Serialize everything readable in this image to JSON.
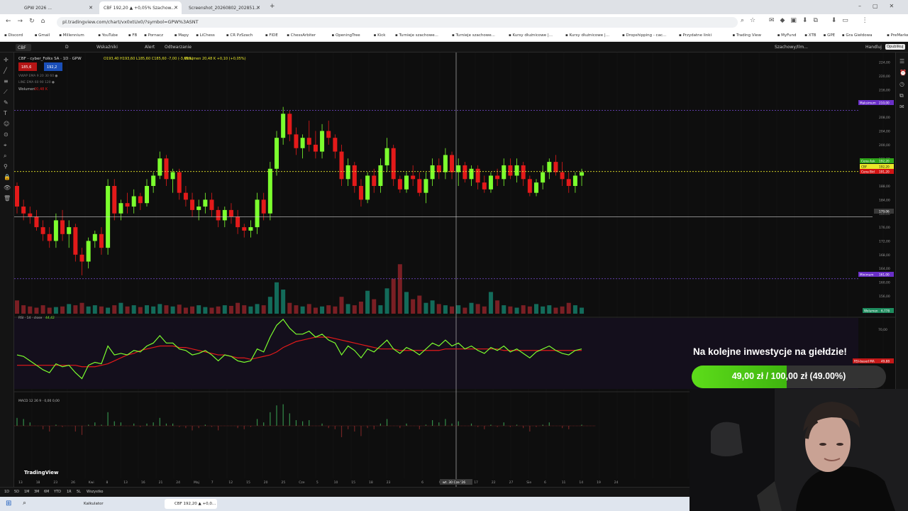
{
  "browser": {
    "tabs": [
      {
        "label": "GPW 2026 ..."
      },
      {
        "label": "CBF 192,20 ▲ +0,05% Szachow..."
      },
      {
        "label": "Screenshot_20260802_202851..."
      }
    ],
    "url": "pl.tradingview.com/chart/vx0xtUx0/?symbol=GPW%3ASNT",
    "bookmarks": [
      "Discord",
      "Gmail",
      "Millennium",
      "YouTube",
      "FB",
      "Pornacz",
      "Mapy",
      "LiChess",
      "CR PzSzach",
      "FIDE",
      "ChessArbiter",
      "OpeningTree",
      "Kick",
      "Turnieje szachowe...",
      "Turnieje szachowe...",
      "Kursy dłużnicowe |...",
      "Kursy dłużnicowe |...",
      "Dropshipping - cac...",
      "Przydatne linki",
      "Trading View",
      "MyFund",
      "XTB",
      "GPE",
      "Gra Giełdowa",
      "PreMarket (MU)"
    ]
  },
  "toolbar": {
    "symbol": "CBF",
    "interval": "D",
    "items": [
      "Wskaźniki",
      "Alert",
      "Odtwarzanie"
    ],
    "right_items": [
      "Szachowy/Ilm...",
      "Handluj",
      "Opublikuj"
    ]
  },
  "legend": {
    "title": "CBF - cyber_Folks SA · 1D · GPW",
    "ohlc": "O193,40 H193,60 L185,60 C185,60 -7,00 (-3,65%)",
    "volume_inline": "Wolumen 20,48 K  +0,10 (+0,05%)",
    "sell": "185,6",
    "buy": "192,2",
    "ind1": "VWAP EMA 9 20 30 60 ●",
    "ind2": "LINE EMA 60 90 120 ●",
    "vol_label": "Wolumen",
    "vol_value": "20,48 K",
    "rsi_label": "RSI · 14 · close",
    "rsi_value": "44,42",
    "macd_label": "MACD 12 26 9 · 0,00 0,00"
  },
  "price_axis": {
    "ticks": [
      "224,00",
      "220,00",
      "216,00",
      "212,00",
      "208,00",
      "204,00",
      "200,00",
      "196,00",
      "192,00",
      "188,00",
      "184,00",
      "180,00",
      "176,00",
      "172,00",
      "168,00",
      "164,00",
      "160,00",
      "156,00",
      "152,00"
    ],
    "max_label": "Maksimum",
    "max_value": "210,00",
    "min_label": "Minimum",
    "min_value": "161,00",
    "ask_label": "Cena Ask",
    "ask_value": "192,20",
    "cbf_label": "CBF",
    "cbf_value": "192,20",
    "bid_label": "Cena Bid",
    "bid_value": "191,20",
    "cursor_value": "179,06",
    "vol_axis_label": "Wolumen",
    "vol_axis_value": "6,778",
    "rsi_ticks": [
      "70,00",
      "60,00",
      "50,00"
    ],
    "rsi_badge": "RSI-based MA",
    "rsi_badge_value": "49,88"
  },
  "time_axis": {
    "labels": [
      "13",
      "18",
      "23",
      "26",
      "Kwi",
      "8",
      "13",
      "16",
      "21",
      "24",
      "Maj",
      "7",
      "12",
      "15",
      "20",
      "25",
      "Cze",
      "5",
      "10",
      "15",
      "18",
      "23",
      "30 Cze '26",
      "6",
      "9",
      "14",
      "17",
      "22",
      "27",
      "Sie",
      "6",
      "11",
      "14",
      "19",
      "24"
    ],
    "cursor_label": "wt. 30 Cze '26"
  },
  "bottom": {
    "ranges": [
      "1D",
      "5D",
      "1M",
      "3M",
      "6M",
      "YTD",
      "1R",
      "5L",
      "Wszystko"
    ],
    "brand": "TradingView"
  },
  "taskbar": {
    "apps": [
      "Kalkulator",
      "CBF 192,20 ▲ +0,0..."
    ]
  },
  "overlay": {
    "title": "Na kolejne inwestycje na giełdzie!",
    "progress_text": "49,00 zł / 100,00 zł (49.00%)",
    "progress": 0.49
  },
  "colors": {
    "up": "#7cff2e",
    "down": "#e31a1a",
    "volume_up": "#136b5a",
    "volume_down": "#7a1f24",
    "rsi": "#7cff2e",
    "rsi_ma": "#e31a1a",
    "accent_green": "#4cd30e",
    "max_badge": "#6a2fc7"
  },
  "chart_data": {
    "type": "candlestick",
    "ohlc": [
      [
        188,
        189,
        180,
        182
      ],
      [
        182,
        184,
        178,
        180
      ],
      [
        180,
        182,
        177,
        179
      ],
      [
        179,
        181,
        175,
        176
      ],
      [
        176,
        178,
        172,
        174
      ],
      [
        174,
        176,
        170,
        172
      ],
      [
        172,
        180,
        170,
        178
      ],
      [
        178,
        181,
        172,
        174
      ],
      [
        174,
        178,
        170,
        176
      ],
      [
        176,
        177,
        166,
        168
      ],
      [
        168,
        170,
        162,
        166
      ],
      [
        166,
        173,
        164,
        172
      ],
      [
        172,
        175,
        170,
        174
      ],
      [
        174,
        176,
        168,
        170
      ],
      [
        170,
        190,
        168,
        188
      ],
      [
        188,
        190,
        178,
        180
      ],
      [
        180,
        184,
        178,
        183
      ],
      [
        183,
        186,
        180,
        182
      ],
      [
        182,
        187,
        180,
        185
      ],
      [
        185,
        186,
        181,
        183
      ],
      [
        183,
        190,
        182,
        188
      ],
      [
        188,
        192,
        186,
        191
      ],
      [
        191,
        198,
        190,
        196
      ],
      [
        196,
        197,
        188,
        190
      ],
      [
        190,
        193,
        186,
        192
      ],
      [
        192,
        193,
        184,
        186
      ],
      [
        186,
        188,
        182,
        184
      ],
      [
        184,
        186,
        179,
        181
      ],
      [
        181,
        184,
        178,
        182
      ],
      [
        182,
        186,
        180,
        184
      ],
      [
        184,
        186,
        179,
        181
      ],
      [
        181,
        182,
        176,
        178
      ],
      [
        178,
        182,
        176,
        181
      ],
      [
        181,
        183,
        177,
        179
      ],
      [
        179,
        181,
        174,
        176
      ],
      [
        176,
        177,
        173,
        175
      ],
      [
        175,
        178,
        173,
        176
      ],
      [
        176,
        186,
        174,
        184
      ],
      [
        184,
        186,
        178,
        180
      ],
      [
        180,
        195,
        178,
        193
      ],
      [
        193,
        204,
        191,
        202
      ],
      [
        202,
        211,
        200,
        209
      ],
      [
        209,
        210,
        201,
        203
      ],
      [
        203,
        205,
        197,
        199
      ],
      [
        199,
        203,
        196,
        202
      ],
      [
        202,
        207,
        198,
        200
      ],
      [
        200,
        204,
        196,
        198
      ],
      [
        198,
        206,
        196,
        204
      ],
      [
        204,
        207,
        200,
        202
      ],
      [
        202,
        203,
        196,
        198
      ],
      [
        198,
        200,
        188,
        190
      ],
      [
        190,
        196,
        188,
        194
      ],
      [
        194,
        195,
        186,
        188
      ],
      [
        188,
        190,
        182,
        184
      ],
      [
        184,
        192,
        183,
        191
      ],
      [
        191,
        193,
        186,
        188
      ],
      [
        188,
        196,
        186,
        194
      ],
      [
        194,
        202,
        192,
        199
      ],
      [
        199,
        200,
        188,
        190
      ],
      [
        190,
        191,
        186,
        187
      ],
      [
        187,
        192,
        186,
        191
      ],
      [
        191,
        194,
        188,
        190
      ],
      [
        190,
        192,
        185,
        186
      ],
      [
        186,
        192,
        183,
        190
      ],
      [
        190,
        196,
        188,
        194
      ],
      [
        194,
        196,
        190,
        192
      ],
      [
        192,
        199,
        190,
        197
      ],
      [
        197,
        198,
        190,
        192
      ],
      [
        192,
        196,
        188,
        194
      ],
      [
        194,
        195,
        189,
        190
      ],
      [
        190,
        194,
        188,
        193
      ],
      [
        193,
        194,
        187,
        189
      ],
      [
        189,
        191,
        186,
        187
      ],
      [
        187,
        192,
        186,
        191
      ],
      [
        191,
        193,
        188,
        190
      ],
      [
        190,
        196,
        188,
        194
      ],
      [
        194,
        196,
        190,
        191
      ],
      [
        191,
        196,
        189,
        194
      ],
      [
        194,
        195,
        188,
        190
      ],
      [
        190,
        191,
        185,
        186
      ],
      [
        186,
        190,
        185,
        189
      ],
      [
        189,
        194,
        187,
        192
      ],
      [
        192,
        196,
        190,
        195
      ],
      [
        195,
        197,
        191,
        192
      ],
      [
        192,
        195,
        188,
        190
      ],
      [
        190,
        192,
        186,
        188
      ],
      [
        188,
        192,
        186,
        191
      ],
      [
        191,
        193,
        188,
        192
      ]
    ],
    "volume": [
      22,
      14,
      12,
      10,
      14,
      10,
      11,
      12,
      16,
      14,
      18,
      12,
      14,
      12,
      10,
      14,
      18,
      12,
      14,
      11,
      14,
      12,
      16,
      14,
      12,
      15,
      10,
      12,
      14,
      11,
      10,
      12,
      14,
      13,
      18,
      14,
      12,
      16,
      14,
      28,
      52,
      40,
      18,
      14,
      12,
      16,
      10,
      12,
      14,
      12,
      28,
      16,
      14,
      20,
      38,
      24,
      14,
      42,
      58,
      82,
      36,
      24,
      30,
      18,
      22,
      16,
      14,
      12,
      14,
      10,
      18,
      16,
      12,
      36,
      22,
      14,
      12,
      10,
      14,
      12,
      16,
      12,
      14,
      10,
      12,
      18,
      14,
      10,
      8
    ],
    "rsi": [
      52,
      51,
      48,
      45,
      42,
      40,
      46,
      44,
      45,
      40,
      36,
      45,
      47,
      46,
      58,
      52,
      53,
      52,
      55,
      54,
      58,
      60,
      65,
      60,
      60,
      56,
      55,
      52,
      53,
      55,
      52,
      48,
      52,
      51,
      48,
      47,
      48,
      56,
      54,
      64,
      72,
      76,
      70,
      66,
      66,
      68,
      64,
      66,
      62,
      60,
      52,
      58,
      55,
      50,
      56,
      54,
      58,
      62,
      56,
      53,
      57,
      55,
      52,
      56,
      60,
      58,
      62,
      58,
      60,
      56,
      58,
      55,
      53,
      57,
      55,
      58,
      54,
      56,
      53,
      50,
      54,
      56,
      58,
      55,
      53,
      52,
      55,
      56
    ],
    "rsi_ma": [
      45,
      45,
      45,
      45,
      45,
      45,
      45,
      45,
      45,
      45,
      44,
      44,
      44,
      45,
      46,
      48,
      50,
      52,
      53,
      55,
      56,
      57,
      58,
      58,
      58,
      57,
      57,
      56,
      55,
      54,
      53,
      52,
      52,
      51,
      50,
      50,
      49,
      50,
      51,
      52,
      54,
      57,
      59,
      61,
      62,
      63,
      64,
      64,
      64,
      63,
      62,
      61,
      60,
      59,
      58,
      57,
      56,
      56,
      56,
      55,
      55,
      55,
      55,
      55,
      55,
      55,
      56,
      56,
      56,
      56,
      56,
      56,
      56,
      56,
      56,
      55,
      55,
      55,
      55,
      55,
      55,
      55,
      55,
      55,
      55,
      55,
      55,
      55
    ],
    "ylim": [
      150,
      226
    ],
    "rsi_ylim": [
      30,
      75
    ]
  }
}
